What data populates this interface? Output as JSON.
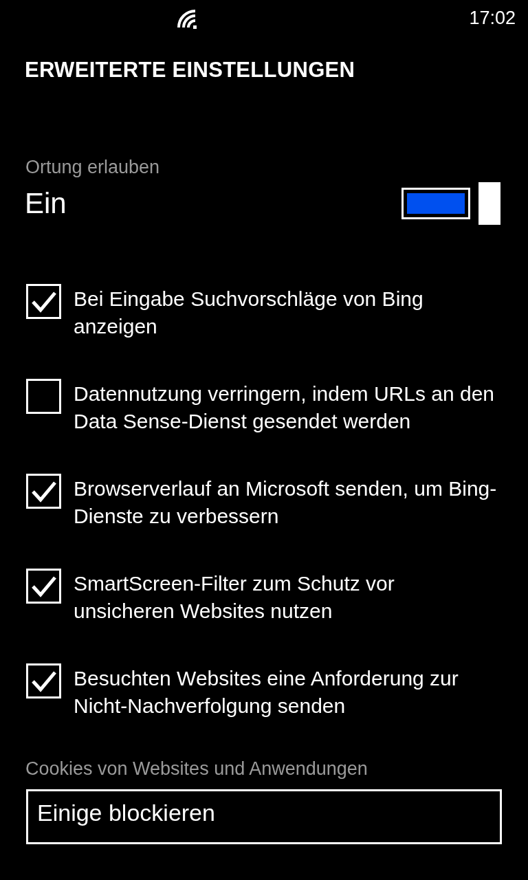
{
  "status_bar": {
    "time": "17:02"
  },
  "title": "ERWEITERTE EINSTELLUNGEN",
  "location": {
    "label": "Ortung erlauben",
    "value": "Ein",
    "on": true
  },
  "options": [
    {
      "label": "Bei Eingabe Suchvorschläge von Bing anzeigen",
      "checked": true
    },
    {
      "label": "Datennutzung verringern, indem URLs an den Data Sense-Dienst gesendet werden",
      "checked": false
    },
    {
      "label": "Browserverlauf an Microsoft senden, um Bing-Dienste zu verbessern",
      "checked": true
    },
    {
      "label": "SmartScreen-Filter zum Schutz vor unsicheren Websites nutzen",
      "checked": true
    },
    {
      "label": "Besuchten Websites eine Anforderung zur Nicht-Nachverfolgung senden",
      "checked": true
    }
  ],
  "cookies": {
    "label": "Cookies von Websites und Anwendungen",
    "value": "Einige blockieren"
  }
}
